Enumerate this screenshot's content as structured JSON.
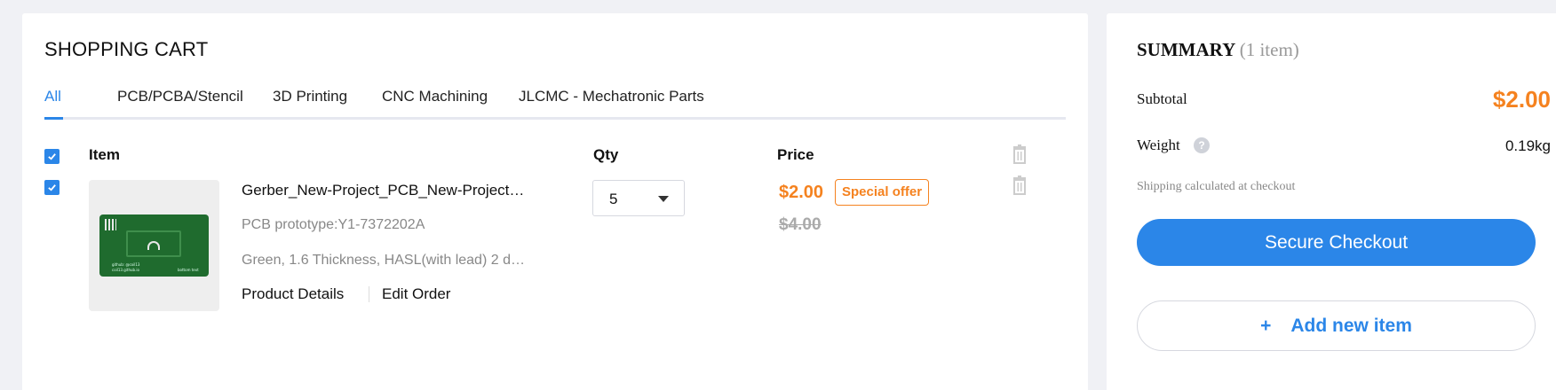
{
  "cart": {
    "title": "SHOPPING CART",
    "tabs": [
      {
        "label": "All"
      },
      {
        "label": "PCB/PCBA/Stencil"
      },
      {
        "label": "3D Printing"
      },
      {
        "label": "CNC Machining"
      },
      {
        "label": "JLCMC - Mechatronic Parts"
      }
    ],
    "columns": {
      "item": "Item",
      "qty": "Qty",
      "price": "Price"
    },
    "item": {
      "name": "Gerber_New-Project_PCB_New-Project_2…",
      "prototype": "PCB prototype:Y1-7372202A",
      "specs": "Green, 1.6 Thickness, HASL(with lead) 2 d…",
      "qty": "5",
      "price": "$2.00",
      "badge": "Special offer",
      "old_price": "$4.00",
      "details_link": "Product Details",
      "edit_link": "Edit Order",
      "thumb_text": {
        "a": "github: @coil13",
        "b": "coil13.github.io",
        "c": "bottom text"
      }
    }
  },
  "summary": {
    "title": "SUMMARY",
    "count": "(1 item)",
    "subtotal_label": "Subtotal",
    "subtotal_value": "$2.00",
    "weight_label": "Weight",
    "weight_value": "0.19kg",
    "help_glyph": "?",
    "shipping_note": "Shipping calculated at checkout",
    "checkout_label": "Secure Checkout",
    "add_plus": "+",
    "add_label": "Add new item"
  },
  "colors": {
    "accent": "#2b86e8",
    "price": "#f5821f",
    "background": "#f0f1f5"
  },
  "icons": [
    "check-icon",
    "trash-icon",
    "chevron-down-icon",
    "help-icon",
    "plus-icon"
  ]
}
